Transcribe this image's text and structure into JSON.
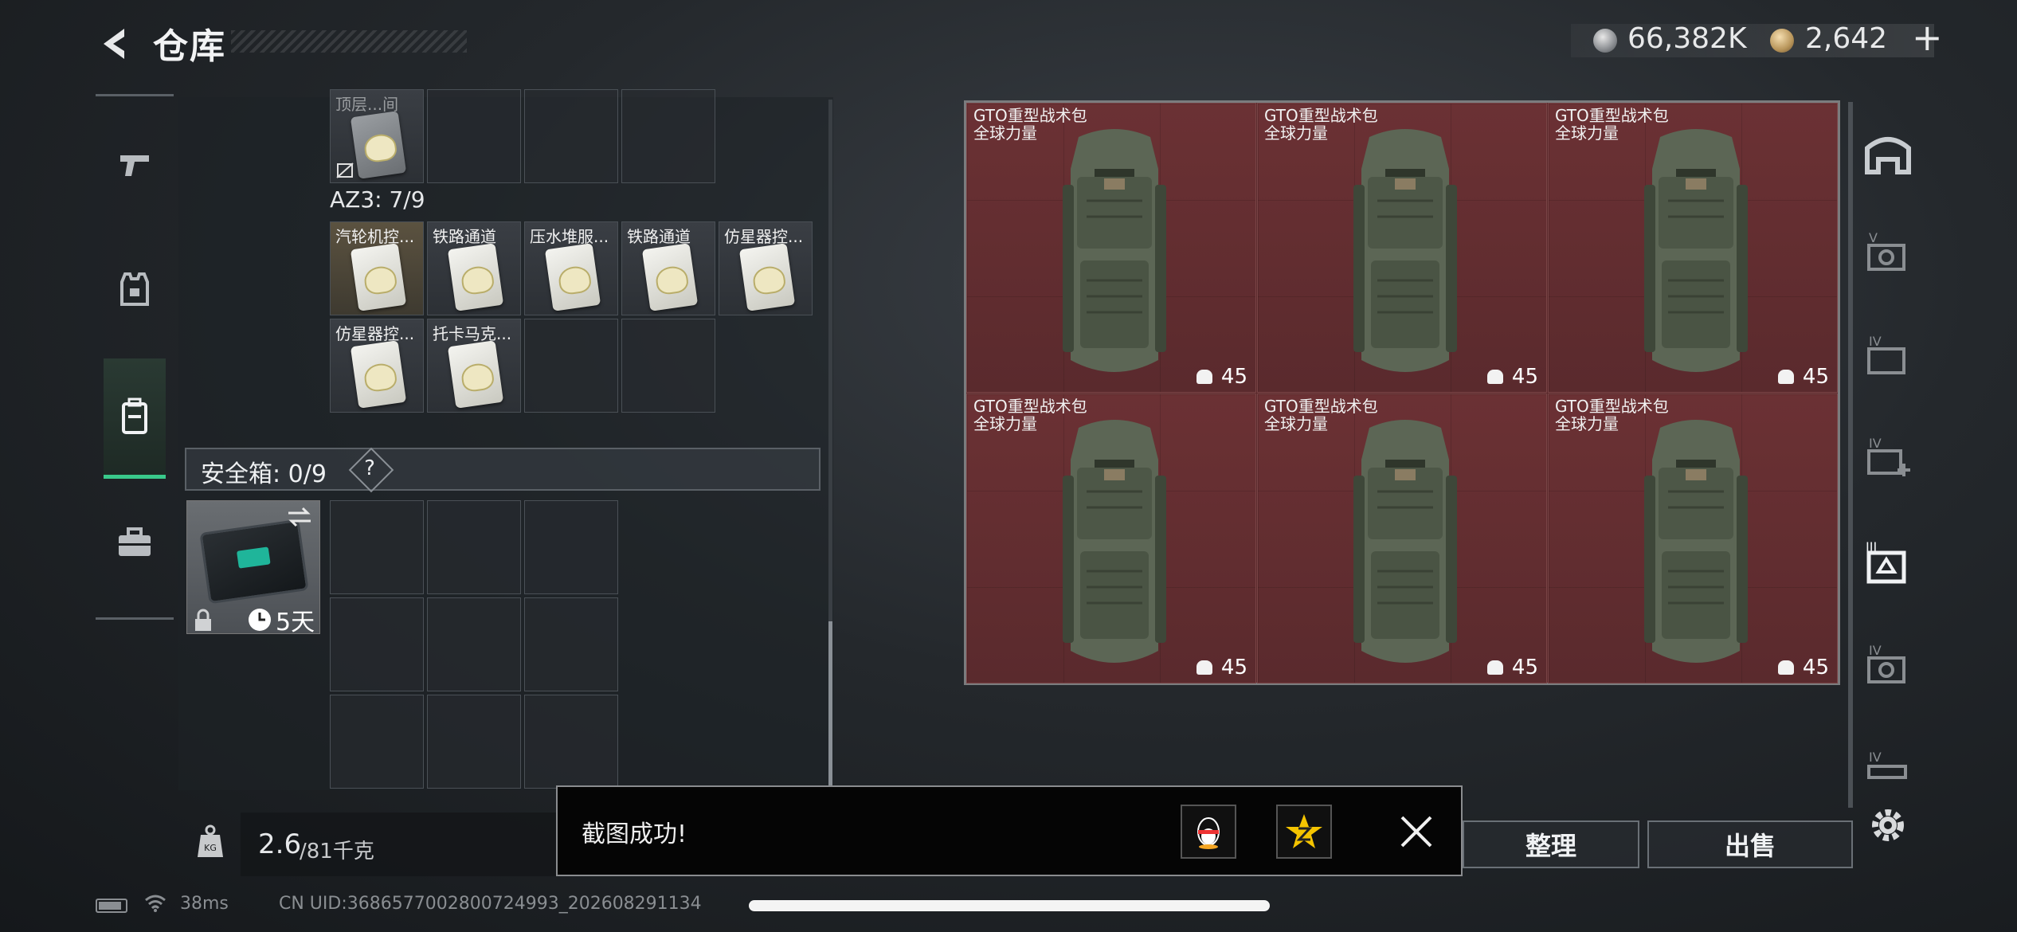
{
  "header": {
    "title": "仓库",
    "silver_currency": "66,382K",
    "gold_currency": "2,642",
    "plus_label": "+"
  },
  "left_rail": {
    "items": [
      {
        "name": "weapons",
        "icon": "pistol-icon"
      },
      {
        "name": "equipment",
        "icon": "vest-icon"
      },
      {
        "name": "backpack",
        "icon": "backpack-icon",
        "active": true
      },
      {
        "name": "supplies",
        "icon": "toolbox-icon"
      }
    ],
    "active_color": "#39c98b"
  },
  "storage": {
    "top_partial_label": "顶层...间",
    "az3_label": "AZ3: 7/9",
    "keycards": [
      {
        "label": "汽轮机控...",
        "rarity": "gold"
      },
      {
        "label": "铁路通道",
        "rarity": "normal"
      },
      {
        "label": "压水堆服...",
        "rarity": "normal"
      },
      {
        "label": "铁路通道",
        "rarity": "normal"
      },
      {
        "label": "仿星器控...",
        "rarity": "normal"
      },
      {
        "label": "仿星器控...",
        "rarity": "normal"
      },
      {
        "label": "托卡马克...",
        "rarity": "normal"
      }
    ],
    "safe_box": {
      "label": "安全箱: 0/9",
      "help": "?",
      "days": "5天"
    }
  },
  "weight": {
    "icon_text": "KG",
    "current": "2.6",
    "max": "/81千克"
  },
  "right_grid": {
    "items": [
      {
        "name": "GTO重型战术包",
        "sub": "全球力量",
        "count": "45"
      },
      {
        "name": "GTO重型战术包",
        "sub": "全球力量",
        "count": "45"
      },
      {
        "name": "GTO重型战术包",
        "sub": "全球力量",
        "count": "45"
      },
      {
        "name": "GTO重型战术包",
        "sub": "全球力量",
        "count": "45"
      },
      {
        "name": "GTO重型战术包",
        "sub": "全球力量",
        "count": "45"
      },
      {
        "name": "GTO重型战术包",
        "sub": "全球力量",
        "count": "45"
      }
    ],
    "bg_color": "#5a2a2c"
  },
  "buttons": {
    "sort": "整理",
    "sell": "出售"
  },
  "toast": {
    "message": "截图成功!"
  },
  "status": {
    "ping": "38ms",
    "uid": "CN UID:3686577002800724993_202608291134"
  }
}
